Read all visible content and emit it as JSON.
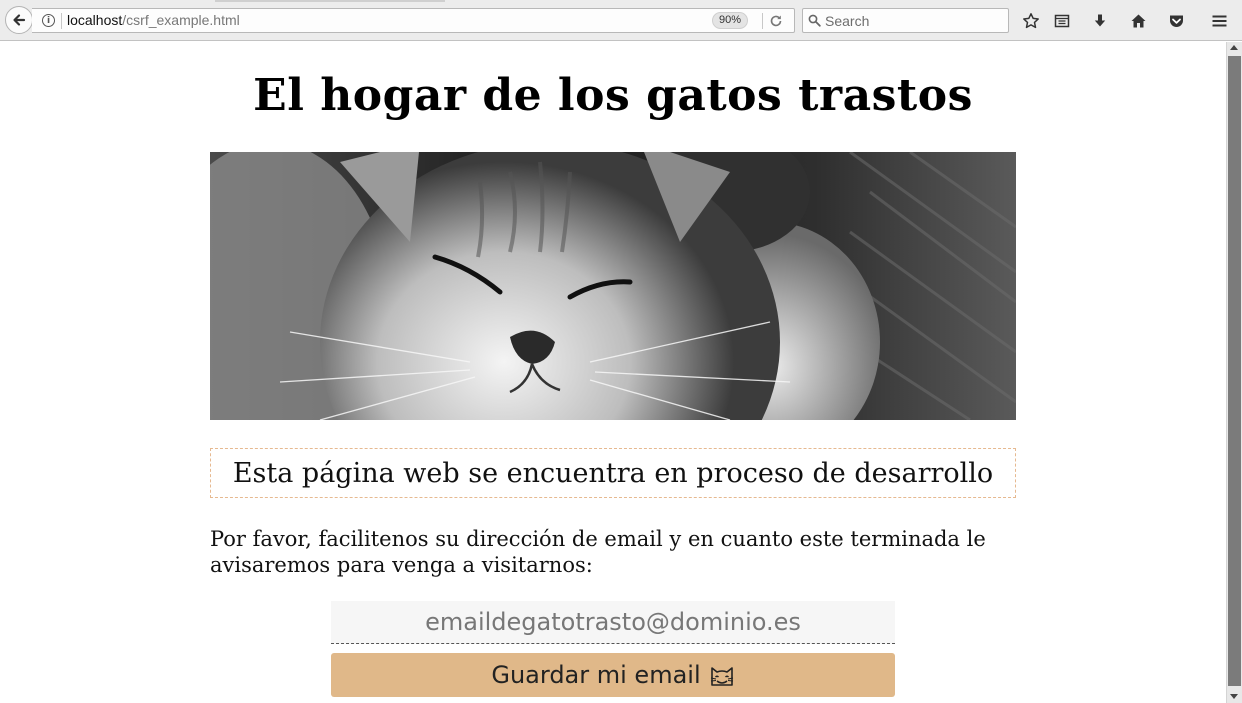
{
  "browser": {
    "url_host": "localhost",
    "url_path": "/csrf_example.html",
    "zoom": "90%",
    "search_placeholder": "Search",
    "toolbar_icons": [
      "star-icon",
      "reading-list-icon",
      "download-icon",
      "home-icon",
      "pocket-icon",
      "menu-icon"
    ]
  },
  "page": {
    "title": "El hogar de los gatos trastos",
    "hero_image": "sleeping-kitten-photo",
    "notice": "Esta página web se encuentra en proceso de desarrollo",
    "prompt": "Por favor, facilitenos su dirección de email y en cuanto este terminada le avisaremos para venga a visitarnos:",
    "email_placeholder": "emaildegatotrasto@dominio.es",
    "save_label": "Guardar mi email",
    "save_icon": "cat-face-icon"
  },
  "colors": {
    "button": "#e0b889",
    "notice_border": "#e6b990",
    "input_bg": "#f6f6f6"
  }
}
